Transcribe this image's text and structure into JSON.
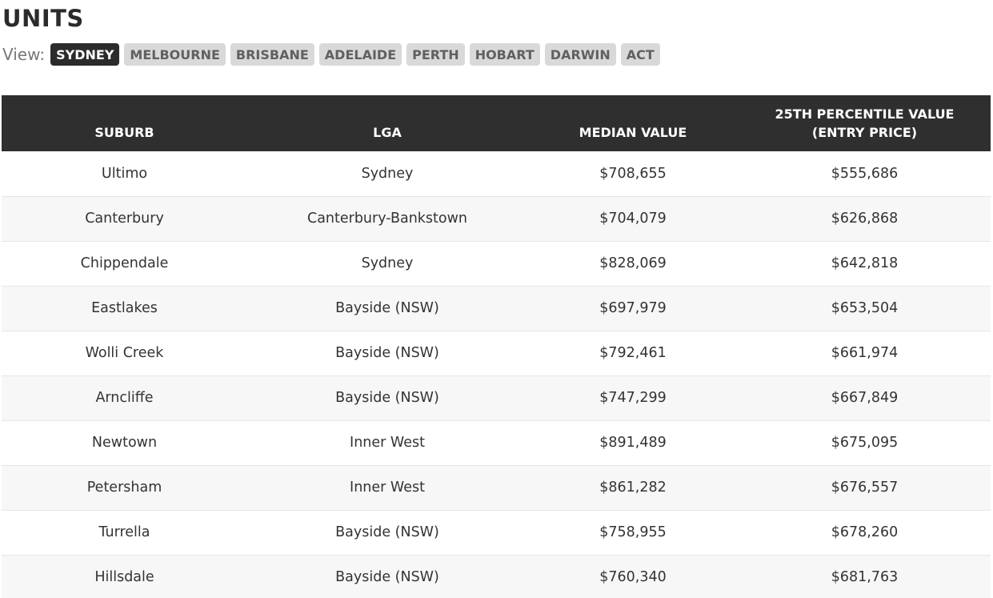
{
  "page": {
    "title": "UNITS",
    "view_label": "View:"
  },
  "tabs": [
    {
      "label": "SYDNEY",
      "active": true
    },
    {
      "label": "MELBOURNE",
      "active": false
    },
    {
      "label": "BRISBANE",
      "active": false
    },
    {
      "label": "ADELAIDE",
      "active": false
    },
    {
      "label": "PERTH",
      "active": false
    },
    {
      "label": "HOBART",
      "active": false
    },
    {
      "label": "DARWIN",
      "active": false
    },
    {
      "label": "ACT",
      "active": false
    }
  ],
  "table": {
    "headers": {
      "suburb": "SUBURB",
      "lga": "LGA",
      "median": "MEDIAN VALUE",
      "p25_line1": "25TH PERCENTILE VALUE",
      "p25_line2": "(ENTRY PRICE)"
    },
    "rows": [
      {
        "suburb": "Ultimo",
        "lga": "Sydney",
        "median": "$708,655",
        "p25": "$555,686"
      },
      {
        "suburb": "Canterbury",
        "lga": "Canterbury-Bankstown",
        "median": "$704,079",
        "p25": "$626,868"
      },
      {
        "suburb": "Chippendale",
        "lga": "Sydney",
        "median": "$828,069",
        "p25": "$642,818"
      },
      {
        "suburb": "Eastlakes",
        "lga": "Bayside (NSW)",
        "median": "$697,979",
        "p25": "$653,504"
      },
      {
        "suburb": "Wolli Creek",
        "lga": "Bayside (NSW)",
        "median": "$792,461",
        "p25": "$661,974"
      },
      {
        "suburb": "Arncliffe",
        "lga": "Bayside (NSW)",
        "median": "$747,299",
        "p25": "$667,849"
      },
      {
        "suburb": "Newtown",
        "lga": "Inner West",
        "median": "$891,489",
        "p25": "$675,095"
      },
      {
        "suburb": "Petersham",
        "lga": "Inner West",
        "median": "$861,282",
        "p25": "$676,557"
      },
      {
        "suburb": "Turrella",
        "lga": "Bayside (NSW)",
        "median": "$758,955",
        "p25": "$678,260"
      },
      {
        "suburb": "Hillsdale",
        "lga": "Bayside (NSW)",
        "median": "$760,340",
        "p25": "$681,763"
      }
    ]
  },
  "colors": {
    "header_bg": "#2f2f2f",
    "active_tab_bg": "#2b2b2b",
    "tab_bg": "#d9d9d9",
    "stripe_bg": "#f7f7f7"
  }
}
